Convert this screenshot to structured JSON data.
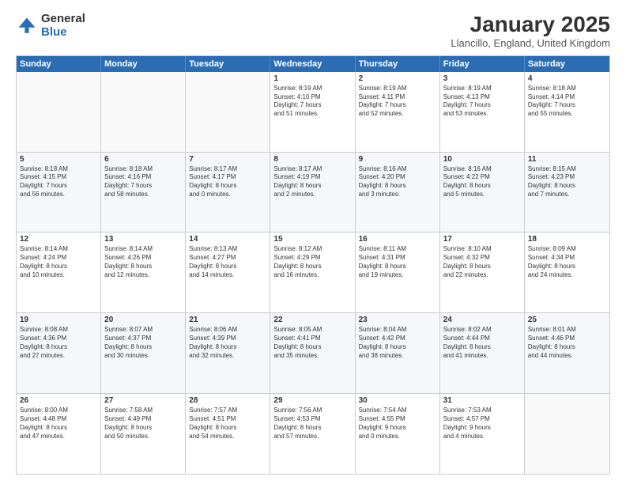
{
  "logo": {
    "general": "General",
    "blue": "Blue"
  },
  "title": "January 2025",
  "location": "Llancillo, England, United Kingdom",
  "days_of_week": [
    "Sunday",
    "Monday",
    "Tuesday",
    "Wednesday",
    "Thursday",
    "Friday",
    "Saturday"
  ],
  "weeks": [
    [
      {
        "day": "",
        "info": ""
      },
      {
        "day": "",
        "info": ""
      },
      {
        "day": "",
        "info": ""
      },
      {
        "day": "1",
        "info": "Sunrise: 8:19 AM\nSunset: 4:10 PM\nDaylight: 7 hours\nand 51 minutes."
      },
      {
        "day": "2",
        "info": "Sunrise: 8:19 AM\nSunset: 4:11 PM\nDaylight: 7 hours\nand 52 minutes."
      },
      {
        "day": "3",
        "info": "Sunrise: 8:19 AM\nSunset: 4:13 PM\nDaylight: 7 hours\nand 53 minutes."
      },
      {
        "day": "4",
        "info": "Sunrise: 8:18 AM\nSunset: 4:14 PM\nDaylight: 7 hours\nand 55 minutes."
      }
    ],
    [
      {
        "day": "5",
        "info": "Sunrise: 8:18 AM\nSunset: 4:15 PM\nDaylight: 7 hours\nand 56 minutes."
      },
      {
        "day": "6",
        "info": "Sunrise: 8:18 AM\nSunset: 4:16 PM\nDaylight: 7 hours\nand 58 minutes."
      },
      {
        "day": "7",
        "info": "Sunrise: 8:17 AM\nSunset: 4:17 PM\nDaylight: 8 hours\nand 0 minutes."
      },
      {
        "day": "8",
        "info": "Sunrise: 8:17 AM\nSunset: 4:19 PM\nDaylight: 8 hours\nand 2 minutes."
      },
      {
        "day": "9",
        "info": "Sunrise: 8:16 AM\nSunset: 4:20 PM\nDaylight: 8 hours\nand 3 minutes."
      },
      {
        "day": "10",
        "info": "Sunrise: 8:16 AM\nSunset: 4:22 PM\nDaylight: 8 hours\nand 5 minutes."
      },
      {
        "day": "11",
        "info": "Sunrise: 8:15 AM\nSunset: 4:23 PM\nDaylight: 8 hours\nand 7 minutes."
      }
    ],
    [
      {
        "day": "12",
        "info": "Sunrise: 8:14 AM\nSunset: 4:24 PM\nDaylight: 8 hours\nand 10 minutes."
      },
      {
        "day": "13",
        "info": "Sunrise: 8:14 AM\nSunset: 4:26 PM\nDaylight: 8 hours\nand 12 minutes."
      },
      {
        "day": "14",
        "info": "Sunrise: 8:13 AM\nSunset: 4:27 PM\nDaylight: 8 hours\nand 14 minutes."
      },
      {
        "day": "15",
        "info": "Sunrise: 8:12 AM\nSunset: 4:29 PM\nDaylight: 8 hours\nand 16 minutes."
      },
      {
        "day": "16",
        "info": "Sunrise: 8:11 AM\nSunset: 4:31 PM\nDaylight: 8 hours\nand 19 minutes."
      },
      {
        "day": "17",
        "info": "Sunrise: 8:10 AM\nSunset: 4:32 PM\nDaylight: 8 hours\nand 22 minutes."
      },
      {
        "day": "18",
        "info": "Sunrise: 8:09 AM\nSunset: 4:34 PM\nDaylight: 8 hours\nand 24 minutes."
      }
    ],
    [
      {
        "day": "19",
        "info": "Sunrise: 8:08 AM\nSunset: 4:36 PM\nDaylight: 8 hours\nand 27 minutes."
      },
      {
        "day": "20",
        "info": "Sunrise: 8:07 AM\nSunset: 4:37 PM\nDaylight: 8 hours\nand 30 minutes."
      },
      {
        "day": "21",
        "info": "Sunrise: 8:06 AM\nSunset: 4:39 PM\nDaylight: 8 hours\nand 32 minutes."
      },
      {
        "day": "22",
        "info": "Sunrise: 8:05 AM\nSunset: 4:41 PM\nDaylight: 8 hours\nand 35 minutes."
      },
      {
        "day": "23",
        "info": "Sunrise: 8:04 AM\nSunset: 4:42 PM\nDaylight: 8 hours\nand 38 minutes."
      },
      {
        "day": "24",
        "info": "Sunrise: 8:02 AM\nSunset: 4:44 PM\nDaylight: 8 hours\nand 41 minutes."
      },
      {
        "day": "25",
        "info": "Sunrise: 8:01 AM\nSunset: 4:46 PM\nDaylight: 8 hours\nand 44 minutes."
      }
    ],
    [
      {
        "day": "26",
        "info": "Sunrise: 8:00 AM\nSunset: 4:48 PM\nDaylight: 8 hours\nand 47 minutes."
      },
      {
        "day": "27",
        "info": "Sunrise: 7:58 AM\nSunset: 4:49 PM\nDaylight: 8 hours\nand 50 minutes."
      },
      {
        "day": "28",
        "info": "Sunrise: 7:57 AM\nSunset: 4:51 PM\nDaylight: 8 hours\nand 54 minutes."
      },
      {
        "day": "29",
        "info": "Sunrise: 7:56 AM\nSunset: 4:53 PM\nDaylight: 8 hours\nand 57 minutes."
      },
      {
        "day": "30",
        "info": "Sunrise: 7:54 AM\nSunset: 4:55 PM\nDaylight: 9 hours\nand 0 minutes."
      },
      {
        "day": "31",
        "info": "Sunrise: 7:53 AM\nSunset: 4:57 PM\nDaylight: 9 hours\nand 4 minutes."
      },
      {
        "day": "",
        "info": ""
      }
    ]
  ]
}
